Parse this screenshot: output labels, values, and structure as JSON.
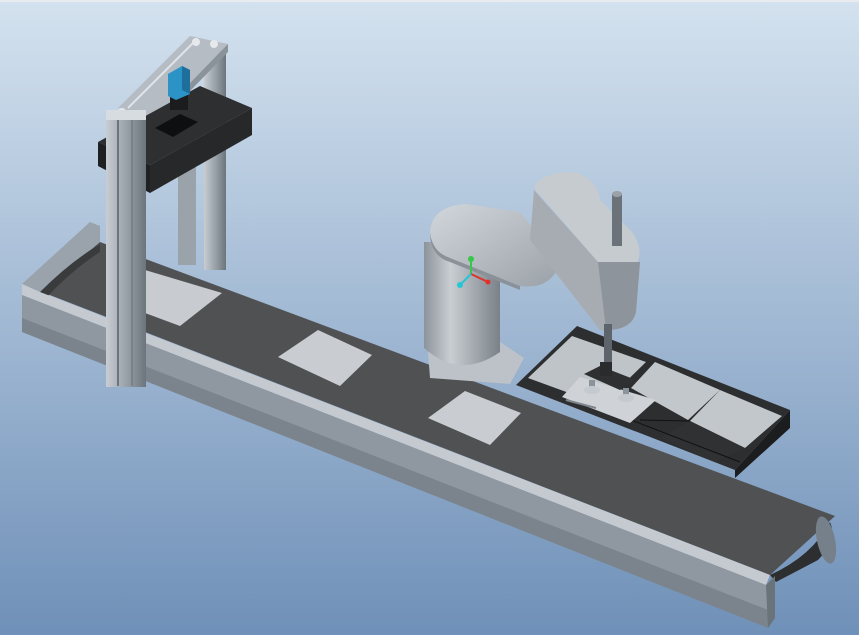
{
  "scene": {
    "background": {
      "top_color": "#d4e2ef",
      "bottom_color": "#6f90b8"
    },
    "colors": {
      "rail_light": "#aeb6bf",
      "rail_mid": "#8a939c",
      "rail_dark": "#5c646c",
      "belt": "#4f5052",
      "belt_dark": "#2f3032",
      "part": "#c9cdd1",
      "robot_light": "#c4c9ce",
      "robot_mid": "#a2a8ae",
      "robot_dark": "#7d848b",
      "camera_housing": "#2a2b2d",
      "camera_body": "#2c93c7",
      "axis_x": "#e0322a",
      "axis_y": "#36c84a",
      "axis_z": "#26c6d6"
    },
    "objects": {
      "conveyor": "belt-conveyor",
      "gantry": "camera-gantry",
      "camera": "inspection-camera",
      "robot": "scara-robot",
      "tray": "parts-tray",
      "gripper": "vacuum-gripper",
      "triad": "coordinate-triad"
    }
  }
}
